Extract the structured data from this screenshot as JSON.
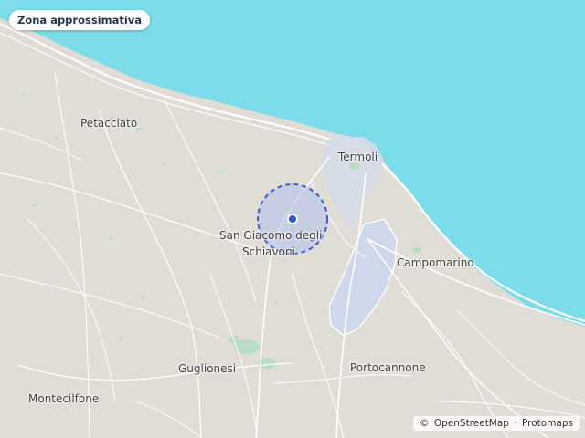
{
  "badge": {
    "label": "Zona approssimativa"
  },
  "places": {
    "petacciato": "Petacciato",
    "termoli": "Termoli",
    "san_giacomo_line1": "San Giacomo degli",
    "san_giacomo_line2": "Schiavoni",
    "campomarino": "Campomarino",
    "guglionesi": "Guglionesi",
    "portocannone": "Portocannone",
    "montecilfone": "Montecilfone"
  },
  "attribution": {
    "copyright": "©",
    "osm": "OpenStreetMap",
    "separator": "·",
    "protomaps": "Protomaps"
  },
  "colors": {
    "land": "#e0ddd6",
    "sea": "#7ddcea",
    "road": "#ffffff",
    "urban": "#d4dbe8",
    "park": "#b9dcc4",
    "radius_fill": "#b3bfec",
    "radius_stroke": "#3b5bdb",
    "marker": "#2b55d9"
  }
}
